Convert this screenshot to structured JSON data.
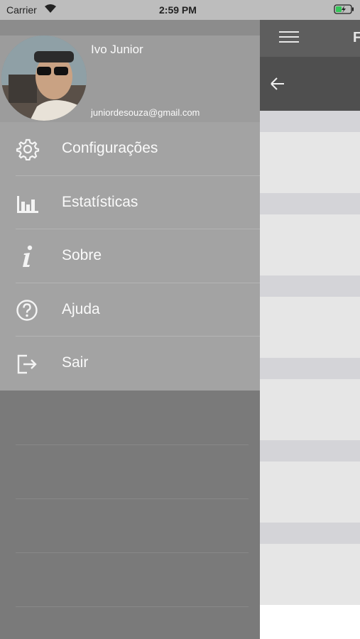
{
  "status_bar": {
    "carrier": "Carrier",
    "time": "2:59 PM"
  },
  "main": {
    "nav_title_partial": "F",
    "hamburger_icon": "hamburger-menu-icon",
    "back_icon": "arrow-left-icon"
  },
  "drawer": {
    "user": {
      "name": "Ivo Junior",
      "email": "juniordesouza@gmail.com"
    },
    "menu_items": [
      {
        "label": "Configurações",
        "icon": "gear-icon"
      },
      {
        "label": "Estatísticas",
        "icon": "bar-chart-icon"
      },
      {
        "label": "Sobre",
        "icon": "info-icon"
      },
      {
        "label": "Ajuda",
        "icon": "help-icon"
      },
      {
        "label": "Sair",
        "icon": "logout-icon"
      }
    ]
  },
  "colors": {
    "nav_bar": "#5e5e5e",
    "drawer": "#a3a3a3",
    "text": "#fafafa"
  }
}
